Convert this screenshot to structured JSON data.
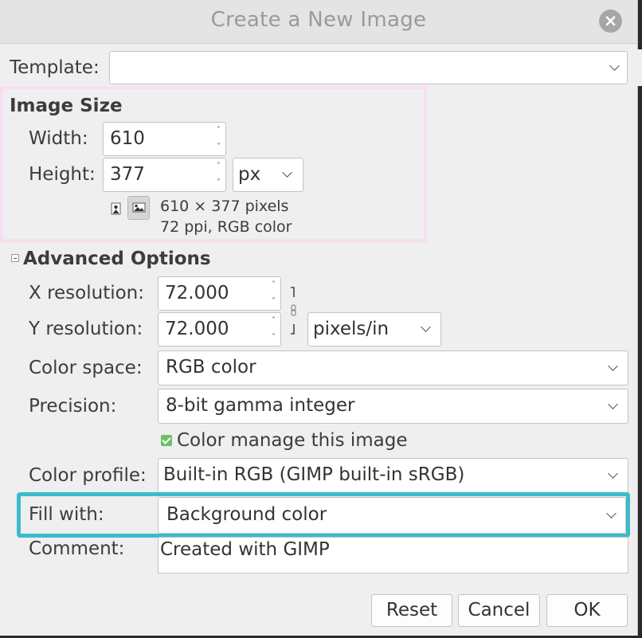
{
  "dialog": {
    "title": "Create a New Image"
  },
  "template": {
    "label": "Template:",
    "value": ""
  },
  "image_size": {
    "heading": "Image Size",
    "width_label": "Width:",
    "width_value": "610",
    "height_label": "Height:",
    "height_value": "377",
    "unit": "px",
    "info_line1": "610 × 377 pixels",
    "info_line2": "72 ppi, RGB color"
  },
  "advanced": {
    "heading": "Advanced Options",
    "x_res_label": "X resolution:",
    "x_res_value": "72.000",
    "y_res_label": "Y resolution:",
    "y_res_value": "72.000",
    "res_unit": "pixels/in",
    "color_space_label": "Color space:",
    "color_space_value": "RGB color",
    "precision_label": "Precision:",
    "precision_value": "8-bit gamma integer",
    "color_manage_label": "Color manage this image",
    "color_manage_checked": true,
    "color_profile_label": "Color profile:",
    "color_profile_value": "Built-in RGB (GIMP built-in sRGB)",
    "fill_label": "Fill with:",
    "fill_value": "Background color",
    "comment_label": "Comment:",
    "comment_value": "Created with GIMP"
  },
  "buttons": {
    "reset": "Reset",
    "cancel": "Cancel",
    "ok": "OK"
  },
  "colors": {
    "highlight_pink": "#f7dff1",
    "highlight_blue": "#3bbccc",
    "check_green": "#6cbf6c"
  }
}
